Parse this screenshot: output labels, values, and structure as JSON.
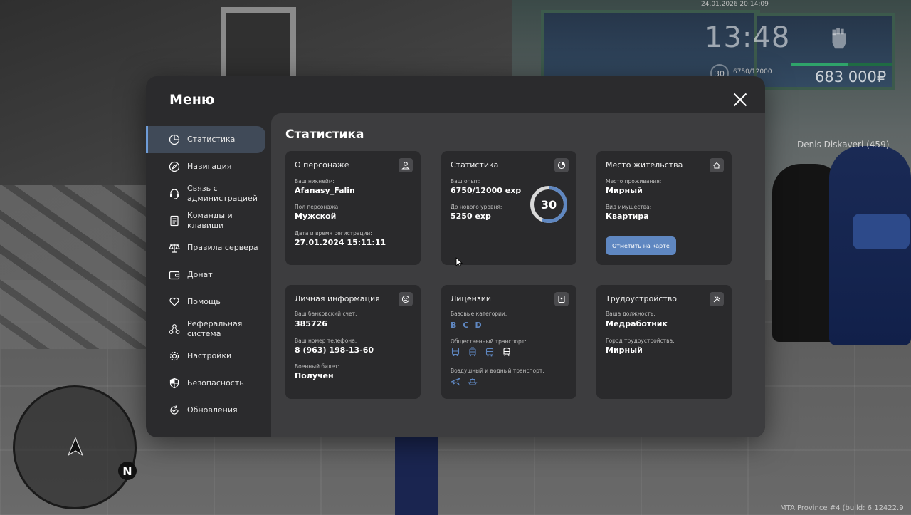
{
  "hud": {
    "datetime": "24.01.2026 20:14:09",
    "time": "13:48",
    "level": "30",
    "exp": "6750/12000",
    "exp_progress": 0.5625,
    "money": "683 000₽",
    "nametag": "Denis Diskaveri (459)",
    "watermark": "MTA Province #4 (build: 6.12422.9",
    "compass": "N"
  },
  "menu": {
    "title": "Меню",
    "close_icon": "close-icon",
    "sidebar": [
      {
        "label": "Статистика",
        "icon": "pie-chart-icon",
        "active": true
      },
      {
        "label": "Навигация",
        "icon": "compass-icon",
        "active": false
      },
      {
        "label": "Связь с\nадминистрацией",
        "icon": "headset-icon",
        "active": false
      },
      {
        "label": "Команды и\nклавиши",
        "icon": "document-icon",
        "active": false
      },
      {
        "label": "Правила сервера",
        "icon": "scales-icon",
        "active": false
      },
      {
        "label": "Донат",
        "icon": "wallet-icon",
        "active": false
      },
      {
        "label": "Помощь",
        "icon": "heart-hands-icon",
        "active": false
      },
      {
        "label": "Реферальная\nсистема",
        "icon": "network-icon",
        "active": false
      },
      {
        "label": "Настройки",
        "icon": "gear-icon",
        "active": false
      },
      {
        "label": "Безопасность",
        "icon": "shield-icon",
        "active": false
      },
      {
        "label": "Обновления",
        "icon": "refresh-icon",
        "active": false
      }
    ]
  },
  "stats": {
    "title": "Статистика",
    "character": {
      "title": "О персонаже",
      "icon": "user-icon",
      "nickname_label": "Ваш никнейм:",
      "nickname": "Afanasy_Falin",
      "gender_label": "Пол персонажа:",
      "gender": "Мужской",
      "reg_label": "Дата и время регистрации:",
      "reg": "27.01.2024 15:11:11"
    },
    "statistics": {
      "title": "Статистика",
      "icon": "clock-chart-icon",
      "exp_label": "Ваш опыт:",
      "exp": "6750/12000 exp",
      "next_label": "До нового уровня:",
      "next": "5250 exp",
      "level": "30",
      "progress": 0.5625
    },
    "residence": {
      "title": "Место жительства",
      "icon": "home-icon",
      "place_label": "Место проживания:",
      "place": "Мирный",
      "property_label": "Вид имущества:",
      "property": "Квартира",
      "button": "Отметить на карте"
    },
    "personal": {
      "title": "Личная информация",
      "icon": "smile-icon",
      "bank_label": "Ваш банковский счет:",
      "bank": "385726",
      "phone_label": "Ваш номер телефона:",
      "phone": "8 (963) 198-13-60",
      "military_label": "Военный билет:",
      "military": "Получен"
    },
    "licenses": {
      "title": "Лицензии",
      "icon": "id-card-icon",
      "basic_label": "Базовые категории:",
      "categories": [
        "B",
        "C",
        "D"
      ],
      "public_label": "Общественный транспорт:",
      "public_icons": [
        "bus-icon",
        "tram-icon",
        "trolleybus-icon",
        "train-icon"
      ],
      "air_label": "Воздушный и водный транспорт:",
      "air_icons": [
        "plane-icon",
        "boat-icon"
      ],
      "accent": "#5f87c1"
    },
    "employment": {
      "title": "Трудоустройство",
      "icon": "tools-icon",
      "job_label": "Ваша должность:",
      "job": "Медработник",
      "city_label": "Город трудоустройства:",
      "city": "Мирный"
    }
  }
}
